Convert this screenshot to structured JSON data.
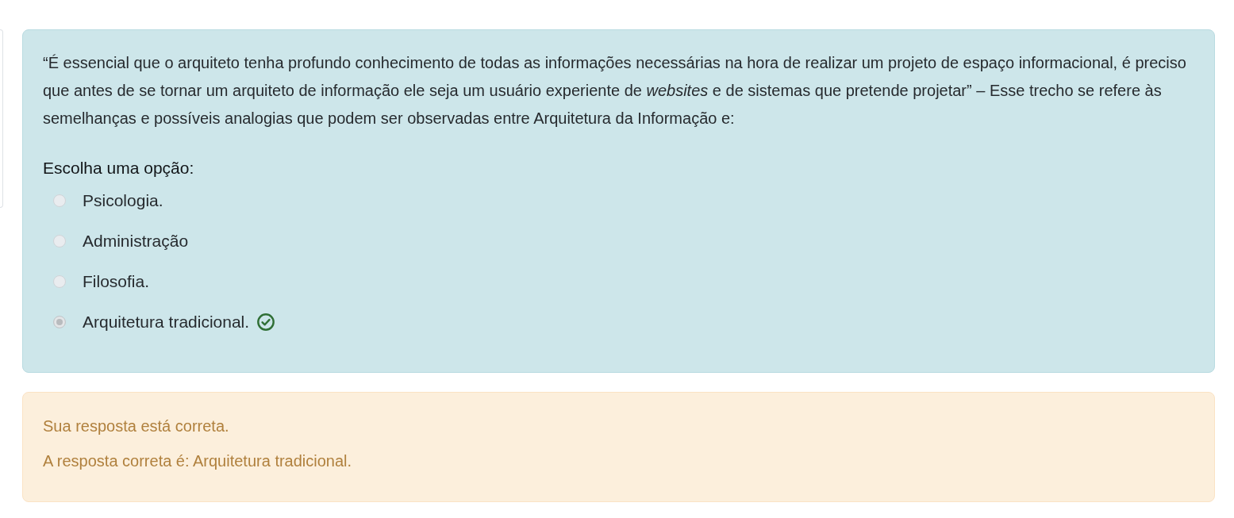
{
  "question": {
    "text": "“É essencial que o arquiteto tenha profundo conhecimento de todas as informações necessárias na hora de realizar um projeto de espaço informacional, é preciso que antes de se tornar um arquiteto de informação ele seja um usuário experiente de *websites* e de sistemas que pretende projetar” – Esse trecho se refere às semelhanças e possíveis analogias que podem ser observadas entre Arquitetura da Informação e:",
    "prompt": "Escolha uma opção:",
    "options": [
      {
        "label": "Psicologia.",
        "selected": false,
        "correct": false
      },
      {
        "label": "Administração",
        "selected": false,
        "correct": false
      },
      {
        "label": "Filosofia.",
        "selected": false,
        "correct": false
      },
      {
        "label": "Arquitetura tradicional.",
        "selected": true,
        "correct": true
      }
    ]
  },
  "feedback": {
    "lines": [
      "Sua resposta está correta.",
      "A resposta correta é: Arquitetura tradicional."
    ]
  }
}
